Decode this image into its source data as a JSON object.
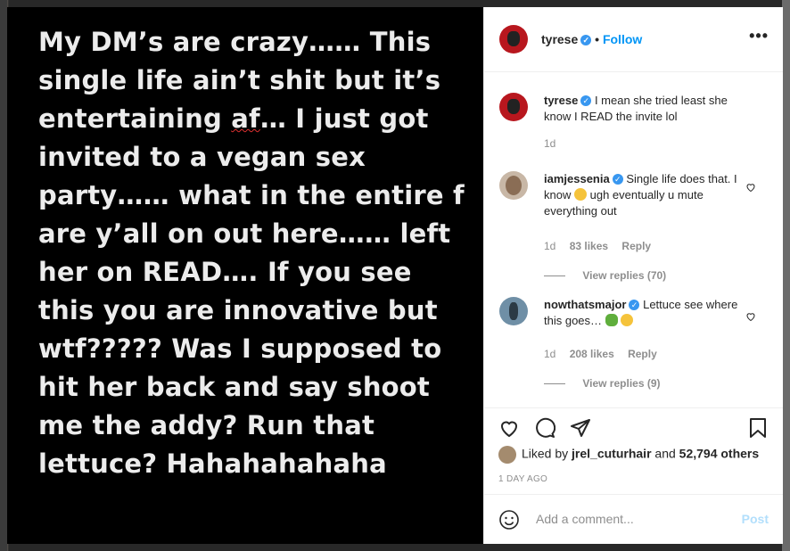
{
  "story": {
    "lines": [
      "My DM’s are crazy……  This",
      "single life ain’t shit but it’s",
      "entertaining af… I just got",
      "invited to a vegan sex",
      "party…… what in the entire f",
      "are y’all on out here…… left",
      "her on READ…. If you see",
      "this you are innovative but",
      "wtf????? Was I supposed to",
      "hit her back and say shoot",
      "me the addy? Run that",
      "lettuce? Hahahahahaha"
    ]
  },
  "header": {
    "username": "tyrese",
    "separator": "•",
    "follow_label": "Follow",
    "more_label": "•••"
  },
  "comments": [
    {
      "username": "tyrese",
      "text": "I mean she tried least she know I READ the invite lol",
      "time": "1d"
    },
    {
      "username": "iamjessenia",
      "text_before": "Single life does that. I know",
      "text_after": "ugh eventually u mute everything out",
      "time": "1d",
      "likes": "83 likes",
      "reply": "Reply",
      "view_replies": "View replies (70)"
    },
    {
      "username": "nowthatsmajor",
      "text": "Lettuce see where this goes…",
      "time": "1d",
      "likes": "208 likes",
      "reply": "Reply",
      "view_replies": "View replies (9)"
    }
  ],
  "likes": {
    "prefix": "Liked by",
    "user": "jrel_cuturhair",
    "middle": "and",
    "others": "52,794 others"
  },
  "date": "1 DAY AGO",
  "add_comment": {
    "placeholder": "Add a comment...",
    "post_label": "Post"
  },
  "colors": {
    "accent": "#0095f6",
    "post_disabled": "#b2dffc",
    "verified": "#3897f0",
    "meta_gray": "#8e8e8e"
  }
}
